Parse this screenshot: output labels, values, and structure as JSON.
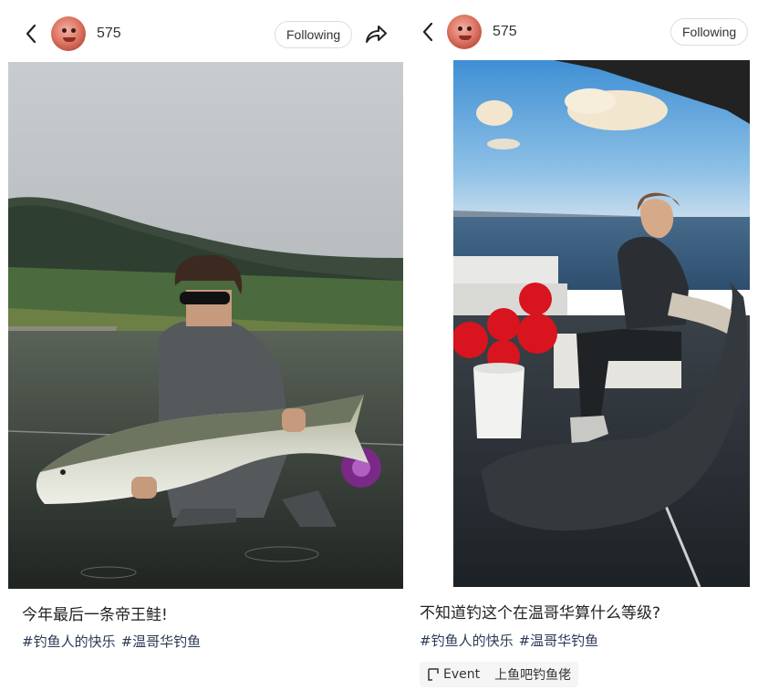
{
  "posts": [
    {
      "author": {
        "name": "575"
      },
      "follow_label": "Following",
      "caption": "今年最后一条帝王鲑!",
      "tags": [
        "#钓鱼人的快乐",
        "#温哥华钓鱼"
      ]
    },
    {
      "author": {
        "name": "575"
      },
      "follow_label": "Following",
      "caption": "不知道钓这个在温哥华算什么等级?",
      "tags": [
        "#钓鱼人的快乐",
        "#温哥华钓鱼"
      ],
      "event": {
        "label": "Event",
        "name": "上鱼吧钓鱼佬"
      }
    }
  ],
  "icons": [
    "back-arrow-icon",
    "share-icon",
    "event-icon"
  ],
  "colors": {
    "hashtag": "#2b3a55",
    "chip_bg": "#f5f5f5",
    "button_border": "#dddddd"
  }
}
